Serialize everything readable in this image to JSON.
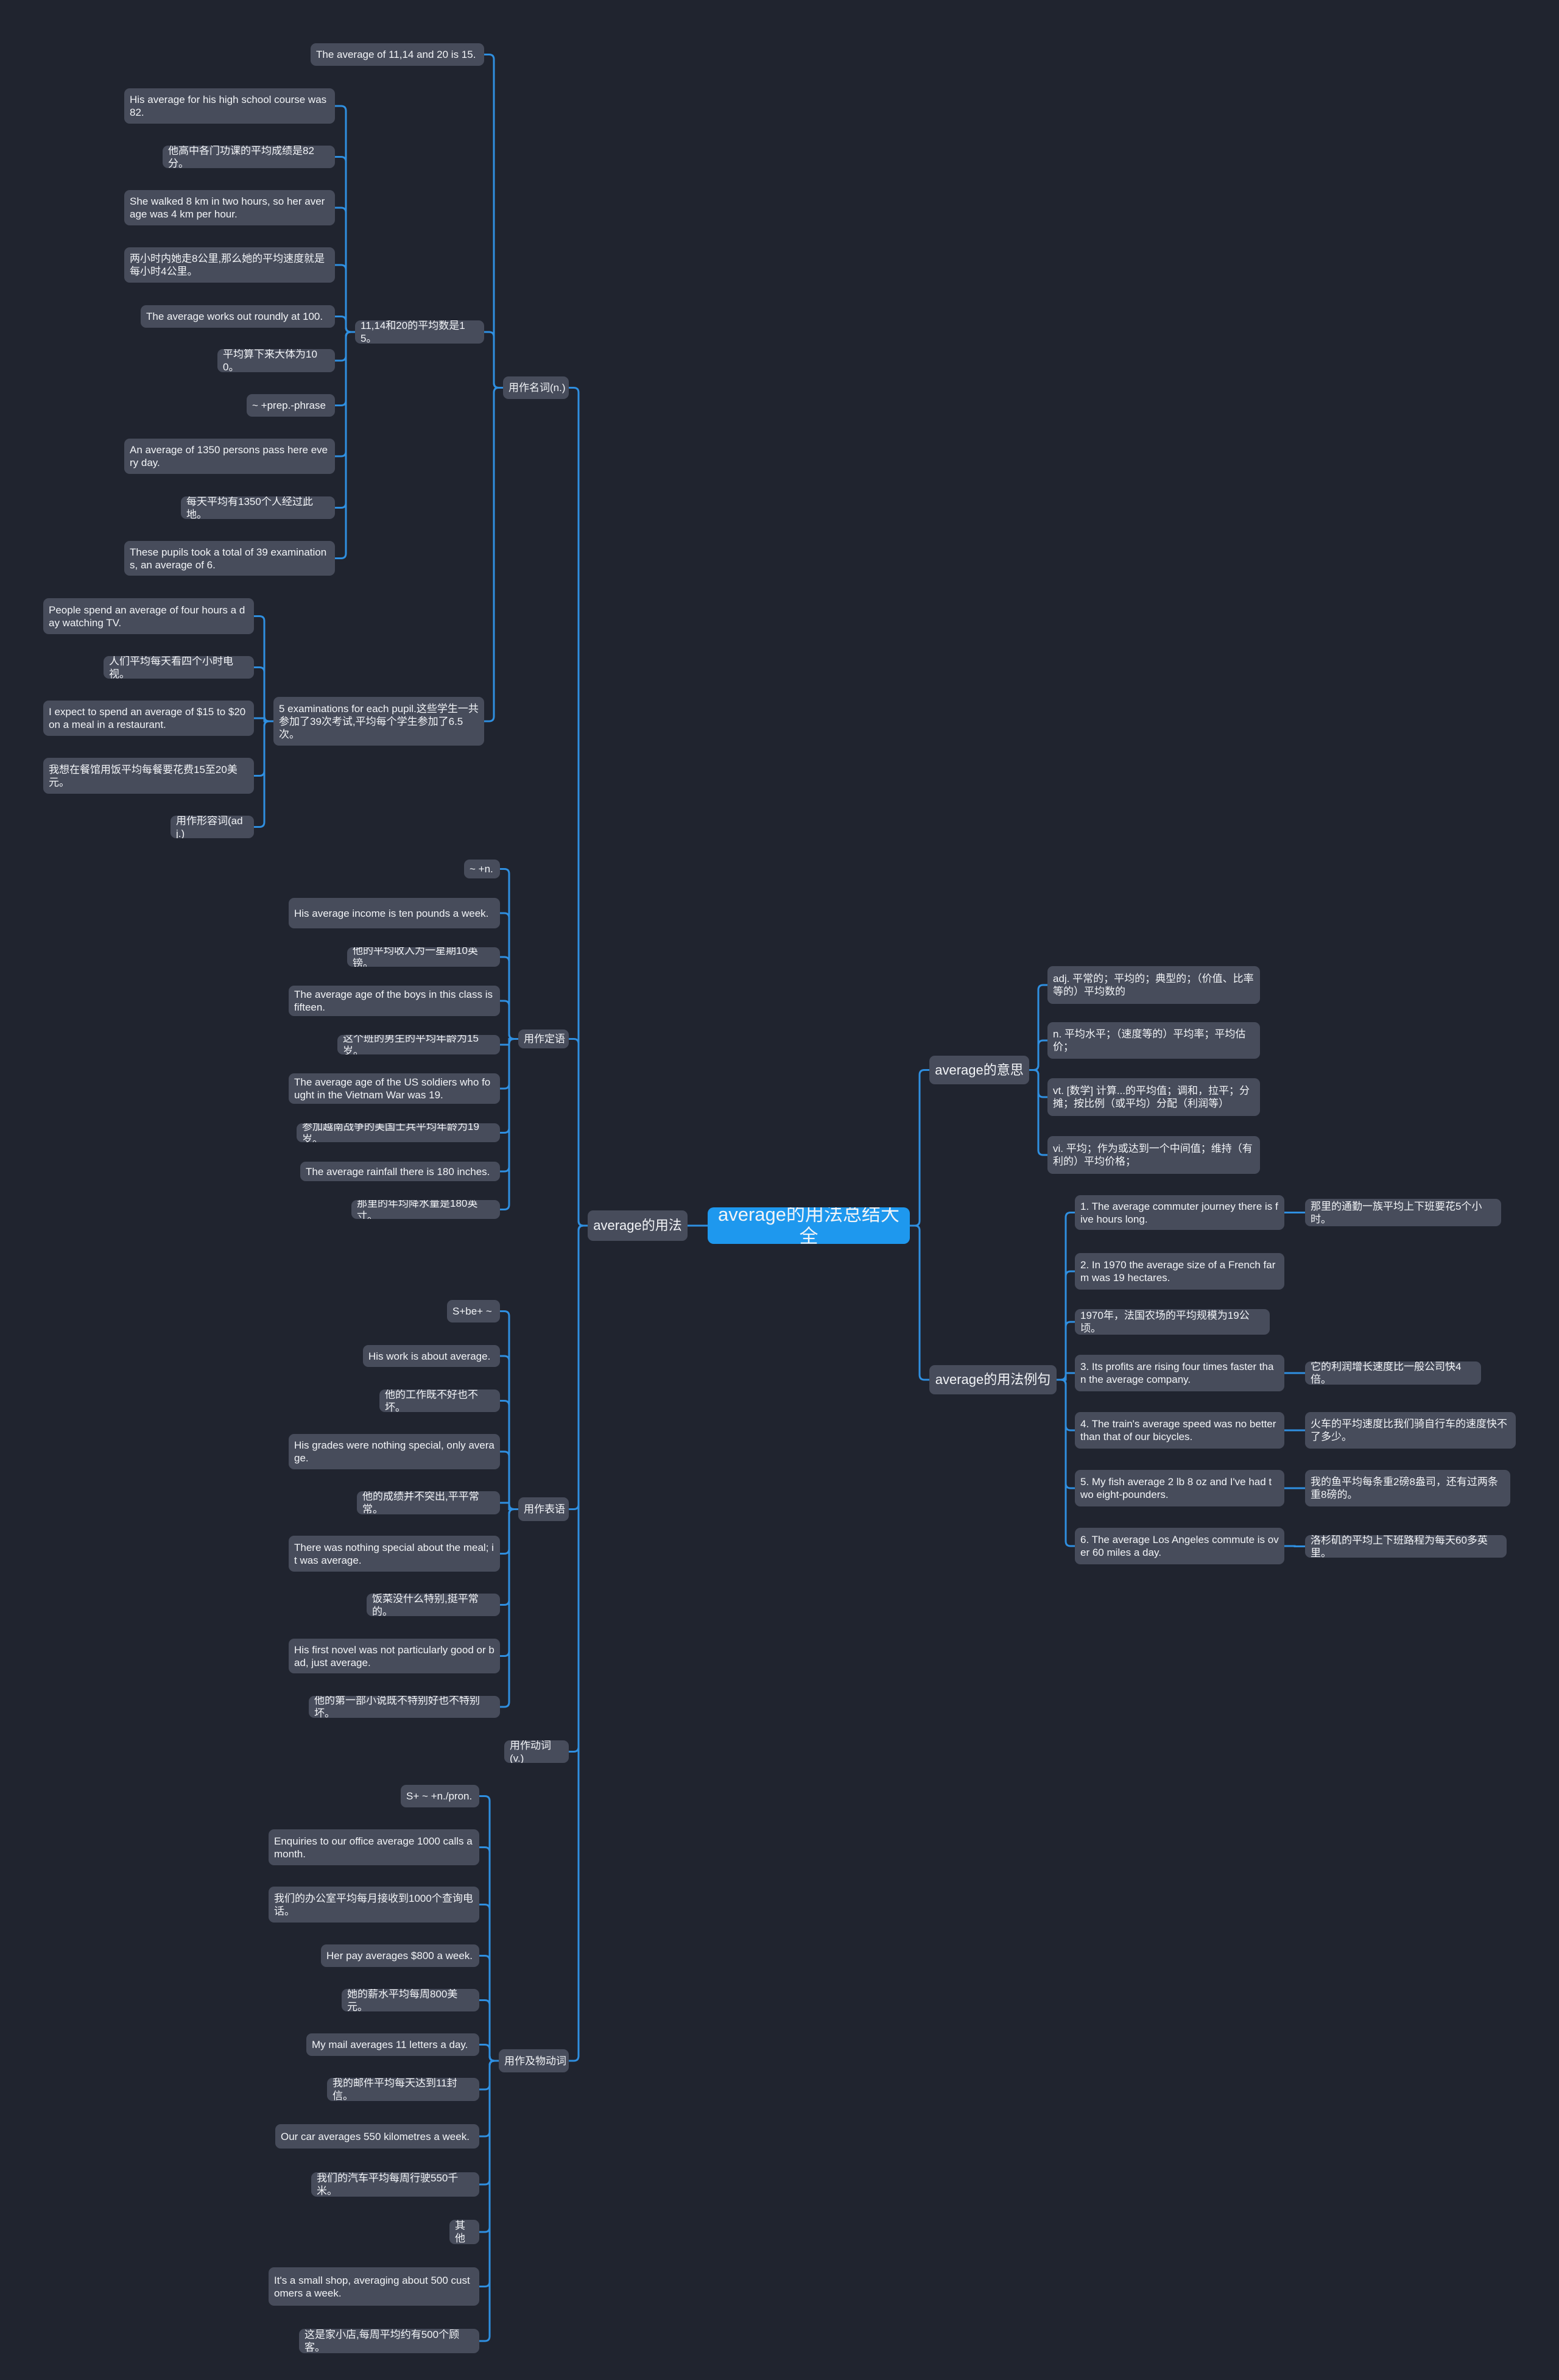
{
  "title": "average的用法总结大全",
  "colors": {
    "background": "#20242f",
    "node": "#474c5b",
    "root": "#1e98ee",
    "link": "#2f8fe0",
    "text": "#f2f4f7"
  },
  "root": {
    "label": "average的用法总结大全",
    "children": [
      {
        "label": "average的用法",
        "side": "left",
        "children": [
          {
            "label": "用作名词(n.)",
            "children": [
              {
                "label": "The average of 11,14 and 20 is 15."
              },
              {
                "label": "11,14和20的平均数是15。",
                "children": [
                  {
                    "label": "His average for his high school course was 82."
                  },
                  {
                    "label": "他高中各门功课的平均成绩是82分。"
                  },
                  {
                    "label": "She walked 8 km in two hours, so her average was 4 km per hour."
                  },
                  {
                    "label": "两小时内她走8公里,那么她的平均速度就是每小时4公里。"
                  },
                  {
                    "label": "The average works out roundly at 100."
                  },
                  {
                    "label": "平均算下来大体为100。"
                  },
                  {
                    "label": "~ +prep.-phrase"
                  },
                  {
                    "label": "An average of 1350 persons pass here every day."
                  },
                  {
                    "label": "每天平均有1350个人经过此地。"
                  },
                  {
                    "label": "These pupils took a total of 39 examinations, an average of 6."
                  }
                ]
              },
              {
                "label": "5 examinations for each pupil.这些学生一共参加了39次考试,平均每个学生参加了6.5次。",
                "children": [
                  {
                    "label": "People spend an average of four hours a day watching TV."
                  },
                  {
                    "label": "人们平均每天看四个小时电视。"
                  },
                  {
                    "label": "I expect to spend an average of $15 to $20 on a meal in a restaurant."
                  },
                  {
                    "label": "我想在餐馆用饭平均每餐要花费15至20美元。"
                  },
                  {
                    "label": "用作形容词(adj.)"
                  }
                ]
              }
            ]
          },
          {
            "label": "用作定语",
            "children": [
              {
                "label": "~ +n."
              },
              {
                "label": "His average income is ten pounds a week."
              },
              {
                "label": "他的平均收入为一星期10英镑。"
              },
              {
                "label": "The average age of the boys in this class is fifteen."
              },
              {
                "label": "这个班的男生的平均年龄为15岁。"
              },
              {
                "label": "The average age of the US soldiers who fought in the Vietnam War was 19."
              },
              {
                "label": "参加越南战争的美国士兵平均年龄为19岁。"
              },
              {
                "label": "The average rainfall there is 180 inches."
              },
              {
                "label": "那里的年均降水量是180英寸。"
              }
            ]
          },
          {
            "label": "用作表语",
            "children": [
              {
                "label": "S+be+ ~"
              },
              {
                "label": "His work is about average."
              },
              {
                "label": "他的工作既不好也不坏。"
              },
              {
                "label": "His grades were nothing special, only average."
              },
              {
                "label": "他的成绩并不突出,平平常常。"
              },
              {
                "label": "There was nothing special about the meal; it was average."
              },
              {
                "label": "饭菜没什么特别,挺平常的。"
              },
              {
                "label": "His first novel was not particularly good or bad, just average."
              },
              {
                "label": "他的第一部小说既不特别好也不特别坏。"
              }
            ]
          },
          {
            "label": "用作动词(v.)"
          },
          {
            "label": "用作及物动词",
            "children": [
              {
                "label": "S+ ~ +n./pron."
              },
              {
                "label": "Enquiries to our office average 1000 calls a month."
              },
              {
                "label": "我们的办公室平均每月接收到1000个查询电话。"
              },
              {
                "label": "Her pay averages $800 a week."
              },
              {
                "label": "她的薪水平均每周800美元。"
              },
              {
                "label": "My mail averages 11 letters a day."
              },
              {
                "label": "我的邮件平均每天达到11封信。"
              },
              {
                "label": "Our car averages 550 kilometres a week."
              },
              {
                "label": "我们的汽车平均每周行驶550千米。"
              },
              {
                "label": "其他"
              },
              {
                "label": "It's a small shop, averaging about 500 customers a week."
              },
              {
                "label": "这是家小店,每周平均约有500个顾客。"
              }
            ]
          }
        ]
      },
      {
        "label": "average的意思",
        "side": "right",
        "children": [
          {
            "label": "adj. 平常的；平均的；典型的；（价值、比率等的）平均数的"
          },
          {
            "label": "n. 平均水平；（速度等的）平均率；平均估价；"
          },
          {
            "label": "vt. [数学] 计算...的平均值；调和，拉平；分摊；按比例（或平均）分配（利润等）"
          },
          {
            "label": "vi. 平均；作为或达到一个中间值；维持（有利的）平均价格；"
          }
        ]
      },
      {
        "label": "average的用法例句",
        "side": "right",
        "children": [
          {
            "label": "1. The average commuter journey there is five hours long.",
            "children": [
              {
                "label": "那里的通勤一族平均上下班要花5个小时。"
              }
            ]
          },
          {
            "label": "2. In 1970 the average size of a French farm was 19 hectares."
          },
          {
            "label": "1970年，法国农场的平均规模为19公顷。"
          },
          {
            "label": "3. Its profits are rising four times faster than the average company.",
            "children": [
              {
                "label": "它的利润增长速度比一般公司快4倍。"
              }
            ]
          },
          {
            "label": "4. The train's average speed was no better than that of our bicycles.",
            "children": [
              {
                "label": "火车的平均速度比我们骑自行车的速度快不了多少。"
              }
            ]
          },
          {
            "label": "5. My fish average 2 lb 8 oz and I've had two eight-pounders.",
            "children": [
              {
                "label": "我的鱼平均每条重2磅8盎司，还有过两条重8磅的。"
              }
            ]
          },
          {
            "label": "6. The average Los Angeles commute is over 60 miles a day.",
            "children": [
              {
                "label": "洛杉矶的平均上下班路程为每天60多英里。"
              }
            ]
          }
        ]
      }
    ]
  }
}
